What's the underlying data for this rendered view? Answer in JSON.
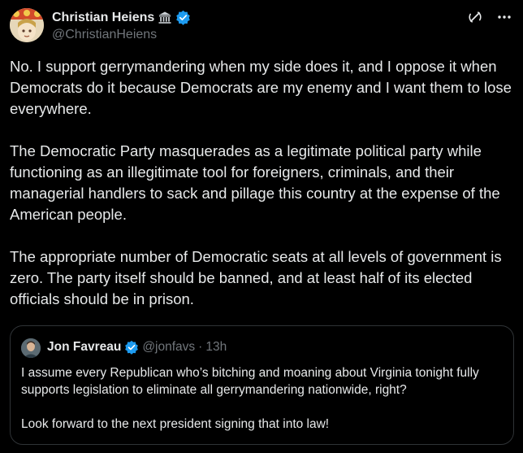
{
  "post": {
    "author": {
      "name": "Christian Heiens",
      "handle": "@ChristianHeiens"
    },
    "paragraphs": [
      "No. I support gerrymandering when my side does it, and I oppose it when Democrats do it because Democrats are my enemy and I want them to lose everywhere.",
      "The Democratic Party masquerades as a legitimate political party while functioning as an illegitimate tool for foreigners, criminals, and their managerial handlers to sack and pillage this country at the expense of the American people.",
      "The appropriate number of Democratic seats at all levels of government is zero. The party itself should be banned, and at least half of its elected officials should be in prison."
    ]
  },
  "quote": {
    "author": {
      "name": "Jon Favreau",
      "handle": "@jonfavs",
      "separator": "·",
      "time": "13h"
    },
    "paragraphs": [
      "I assume every Republican who’s bitching and moaning about Virginia tonight fully supports legislation to eliminate all gerrymandering nationwide, right?",
      "Look forward to the next president signing that into law!"
    ]
  },
  "icons": {
    "government_badge": "classical-building-icon",
    "verified_badge": "verified-badge-icon",
    "grok": "grok-icon",
    "more": "more-options-icon"
  },
  "colors": {
    "background": "#000000",
    "text_primary": "#e7e9ea",
    "text_secondary": "#71767b",
    "verified_blue": "#1d9bf0",
    "border": "#2f3336"
  }
}
